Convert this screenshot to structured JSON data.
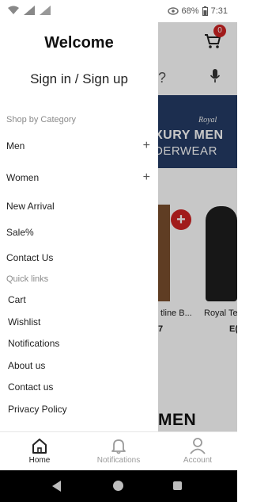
{
  "status_bar": {
    "battery": "68%",
    "time": "7:31"
  },
  "background": {
    "cart_count": "0",
    "search_fragment": "?",
    "banner_brand": "Royal",
    "banner_line1": "XURY MEN",
    "banner_line2": "DERWEAR",
    "add_symbol": "+",
    "product1_name": "tline B...",
    "product1_price": "7",
    "product2_name": "Royal Te",
    "product2_price": "E(",
    "section_heading": "MEN"
  },
  "drawer": {
    "welcome": "Welcome",
    "signin": "Sign in / Sign up",
    "shop_by_category": "Shop by Category",
    "categories": [
      {
        "label": "Men",
        "expand": "+"
      },
      {
        "label": "Women",
        "expand": "+"
      },
      {
        "label": "New Arrival"
      },
      {
        "label": "Sale%"
      },
      {
        "label": "Contact Us"
      }
    ],
    "quick_links_title": "Quick links",
    "quick_links": [
      {
        "label": "Cart"
      },
      {
        "label": "Wishlist"
      },
      {
        "label": "Notifications"
      },
      {
        "label": "About us"
      },
      {
        "label": "Contact us"
      },
      {
        "label": "Privacy Policy"
      }
    ]
  },
  "bottom_nav": {
    "items": [
      {
        "label": "Home",
        "icon": "home-icon",
        "active": true
      },
      {
        "label": "Notifications",
        "icon": "bell-icon",
        "active": false
      },
      {
        "label": "Account",
        "icon": "person-icon",
        "active": false
      }
    ],
    "active_color": "#222222",
    "inactive_color": "#9a9a9a"
  },
  "colors": {
    "accent_red": "#cf2323",
    "banner_navy": "#243c66"
  }
}
